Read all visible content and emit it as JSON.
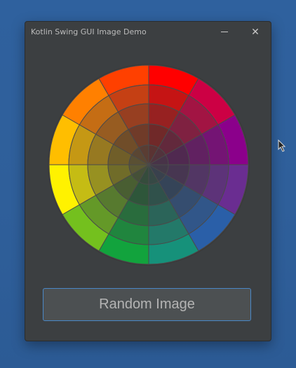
{
  "window": {
    "title": "Kotlin Swing GUI Image Demo"
  },
  "controls": {
    "minimize_icon": "minimize-icon",
    "close_icon": "close-icon",
    "close_glyph": "✕"
  },
  "image": {
    "description_icon": "color-wheel-image",
    "colors": [
      "#ff0000",
      "#cc0044",
      "#8b008b",
      "#6a2d91",
      "#2a5fa8",
      "#16917a",
      "#12a33d",
      "#74c01e",
      "#fff200",
      "#ffbe00",
      "#ff8000",
      "#ff4000"
    ]
  },
  "button": {
    "label": "Random Image"
  }
}
